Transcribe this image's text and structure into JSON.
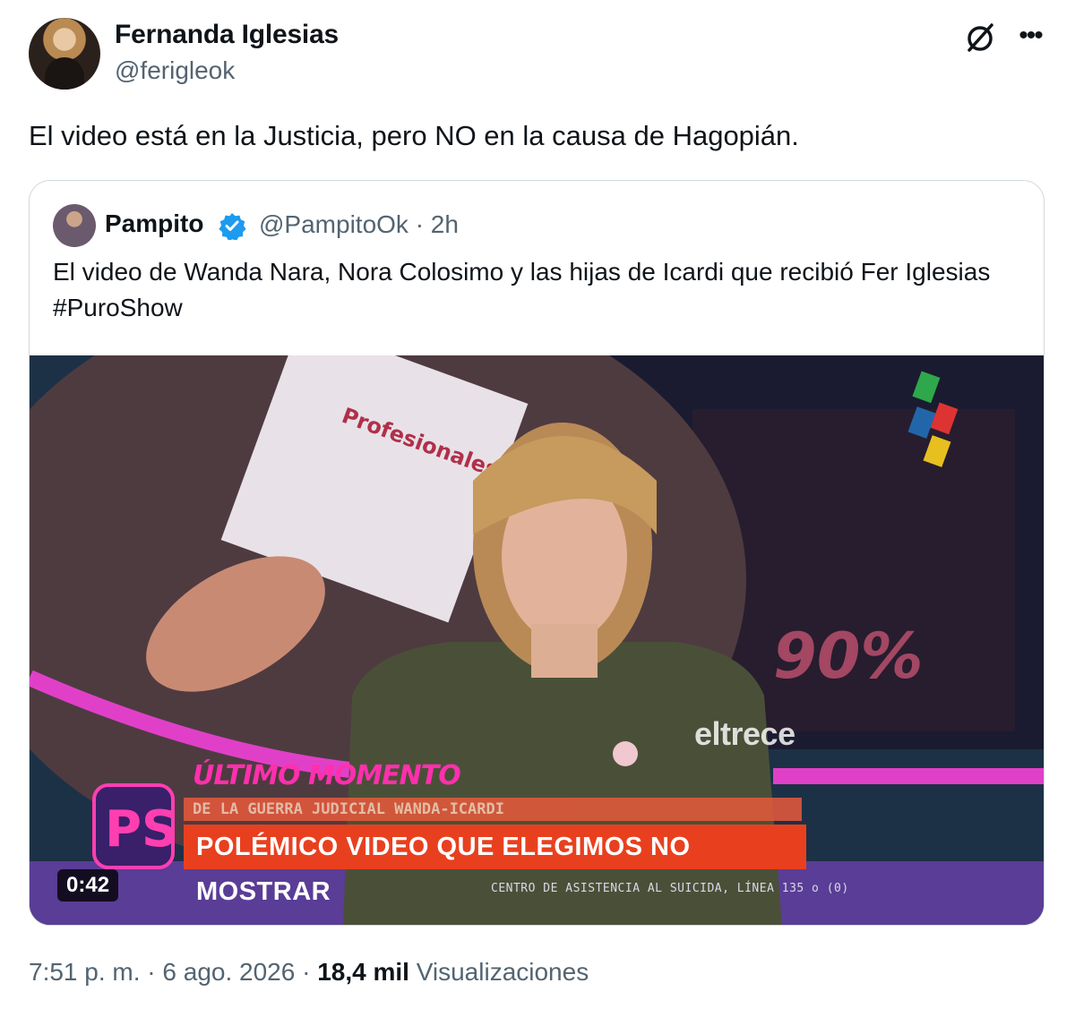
{
  "author": {
    "name": "Fernanda Iglesias",
    "handle": "@ferigleok"
  },
  "tweet": {
    "text": "El video está en la Justicia, pero NO en la causa de Hagopián."
  },
  "quote": {
    "name": "Pampito",
    "handle": "@PampitoOk · 2h",
    "text": "El video de Wanda Nara, Nora Colosimo y las hijas de Icardi que recibió Fer Iglesias #PuroShow",
    "media": {
      "duration": "0:42",
      "channel_logo": "eltrece",
      "banner_kicker": "ÚLTIMO MOMENTO",
      "banner_sub": "DE LA GUERRA JUDICIAL WANDA-ICARDI",
      "banner_main": "POLÉMICO VIDEO QUE ELEGIMOS NO MOSTRAR",
      "ticker": "CENTRO DE ASISTENCIA AL SUICIDA, LÍNEA 135 o (0)"
    }
  },
  "footer": {
    "time": "7:51 p. m. · 6 ago. 2026 · ",
    "views_count": "18,4 mil",
    "views_label": " Visualizaciones"
  },
  "icons": {
    "grok": "grok-icon",
    "more": "more-icon",
    "verified": "verified-badge-icon"
  },
  "colors": {
    "verified": "#1d9bf0",
    "secondary_text": "#536471",
    "banner": "#e8401f"
  }
}
